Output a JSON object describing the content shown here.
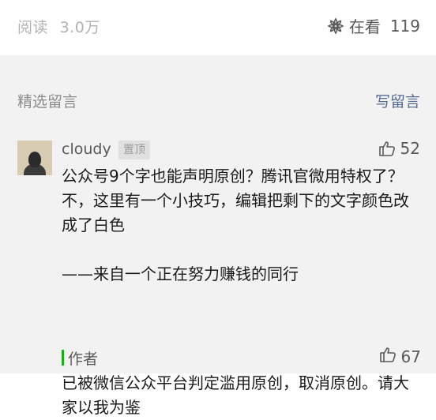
{
  "stats": {
    "read_label": "阅读",
    "read_count": "3.0万",
    "looking_label": "在看",
    "looking_count": "119"
  },
  "comments_section": {
    "title": "精选留言",
    "write_label": "写留言"
  },
  "comment": {
    "nickname": "cloudy",
    "pin_badge": "置顶",
    "likes": "52",
    "text": "公众号9个字也能声明原创？腾讯官微用特权了？不，这里有一个小技巧，编辑把剩下的文字颜色改成了白色\n\n——来自一个正在努力赚钱的同行",
    "reply": {
      "author": "作者",
      "likes": "67",
      "text": "已被微信公众平台判定滥用原创，取消原创。请大家以我为鉴"
    }
  },
  "colors": {
    "link": "#576b95",
    "author_bar": "#1aad19",
    "section_bg": "#f2f2f2"
  },
  "icons": {
    "looking": "flower-icon",
    "like": "thumbs-up-icon"
  }
}
